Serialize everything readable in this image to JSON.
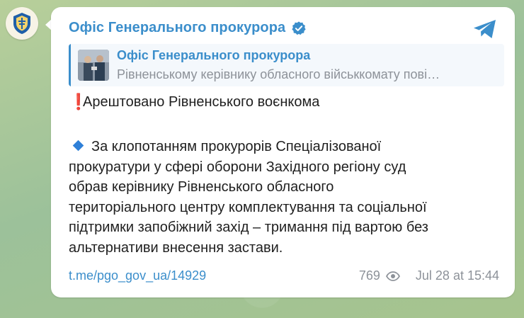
{
  "message": {
    "channel_name": "Офіс Генерального прокурора",
    "reply": {
      "title": "Офіс Генерального прокурора",
      "snippet": "Рівненському керівнику обласного військкомату пові…"
    },
    "headline": "Арештовано Рівненського воєнкома",
    "body_lines": [
      "За клопотанням прокурорів Спеціалізованої",
      "прокуратури у сфері оборони Західного регіону суд",
      "обрав керівнику Рівненського обласного",
      "територіального центру комплектування та соціальної",
      "підтримки запобіжний захід – тримання під вартою без",
      "альтернативи внесення застави."
    ],
    "link": "t.me/pgo_gov_ua/14929",
    "views": "769",
    "date": "Jul 28 at 15:44"
  },
  "icons": {
    "avatar": "prosecutor-emblem-icon",
    "verified": "verified-badge-icon",
    "share": "telegram-share-icon",
    "exclamation": "red-exclamation-icon",
    "diamond": "blue-diamond-icon",
    "views": "eye-icon"
  },
  "colors": {
    "link_blue": "#3b8ecb",
    "exclamation_red": "#e0312e",
    "diamond_blue": "#2f80d8",
    "meta_gray": "#8d9299",
    "background_green": "#a9c79a"
  }
}
